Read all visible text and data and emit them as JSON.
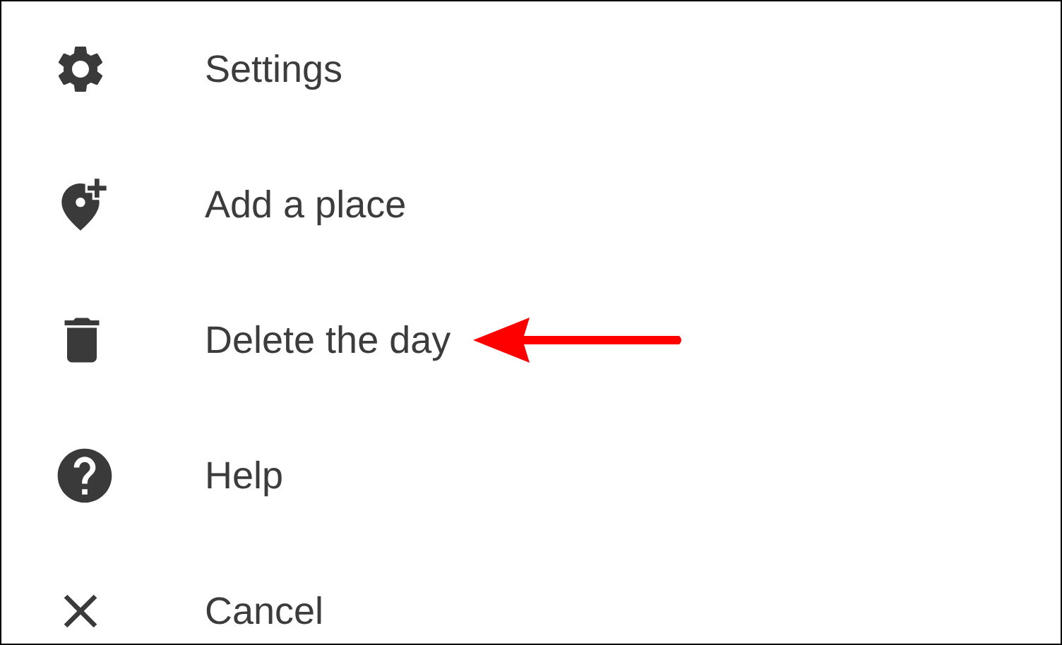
{
  "menu": {
    "items": [
      {
        "label": "Settings",
        "kind": "settings",
        "highlighted": false
      },
      {
        "label": "Add a place",
        "kind": "add-place",
        "highlighted": false
      },
      {
        "label": "Delete the day",
        "kind": "delete",
        "highlighted": true
      },
      {
        "label": "Help",
        "kind": "help",
        "highlighted": false
      },
      {
        "label": "Cancel",
        "kind": "cancel",
        "highlighted": false
      }
    ]
  }
}
